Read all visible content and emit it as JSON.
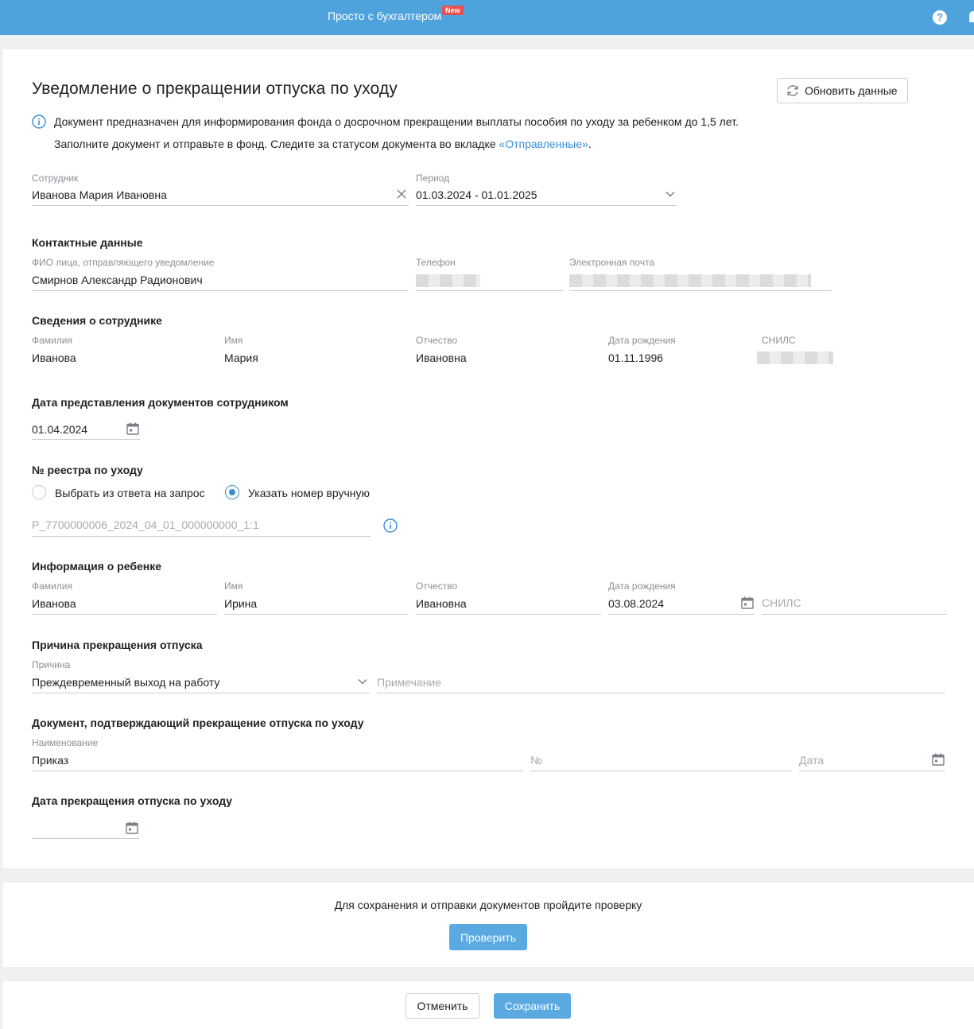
{
  "topbar": {
    "title": "Просто с бухгалтером",
    "badge": "New"
  },
  "header": {
    "title": "Уведомление о прекращении отпуска по уходу",
    "refresh_label": "Обновить данные",
    "info_line1": "Документ предназначен для информирования фонда о досрочном прекращении выплаты пособия по уходу за ребенком до 1,5 лет.",
    "info_line2_prefix": "Заполните документ и отправьте в фонд. Следите за статусом документа во вкладке ",
    "info_link": "«Отправленные»",
    "info_line2_suffix": "."
  },
  "employee": {
    "label": "Сотрудник",
    "value": "Иванова Мария Ивановна",
    "period_label": "Период",
    "period_value": "01.03.2024 - 01.01.2025"
  },
  "contacts": {
    "section": "Контактные данные",
    "fio_label": "ФИО лица, отправляющего уведомление",
    "fio_value": "Смирнов Александр Радионович",
    "phone_label": "Телефон",
    "email_label": "Электронная почта"
  },
  "employee_info": {
    "section": "Сведения о сотруднике",
    "lastname_label": "Фамилия",
    "lastname": "Иванова",
    "firstname_label": "Имя",
    "firstname": "Мария",
    "middlename_label": "Отчество",
    "middlename": "Ивановна",
    "birth_label": "Дата рождения",
    "birth": "01.11.1996",
    "snils_label": "СНИЛС"
  },
  "submit_date": {
    "section": "Дата представления документов сотрудником",
    "value": "01.04.2024"
  },
  "registry": {
    "section": "№ реестра по уходу",
    "option1": "Выбрать из ответа на запрос",
    "option2": "Указать номер вручную",
    "value": "P_7700000006_2024_04_01_000000000_1:1"
  },
  "child": {
    "section": "Информация о ребенке",
    "lastname_label": "Фамилия",
    "lastname": "Иванова",
    "firstname_label": "Имя",
    "firstname": "Ирина",
    "middlename_label": "Отчество",
    "middlename": "Ивановна",
    "birth_label": "Дата рождения",
    "birth": "03.08.2024",
    "snils_placeholder": "СНИЛС"
  },
  "reason": {
    "section": "Причина прекращения отпуска",
    "label": "Причина",
    "value": "Преждевременный выход на работу",
    "note_placeholder": "Примечание"
  },
  "document": {
    "section": "Документ, подтверждающий прекращение отпуска по уходу",
    "name_label": "Наименование",
    "name_value": "Приказ",
    "number_placeholder": "№",
    "date_placeholder": "Дата"
  },
  "end_date": {
    "section": "Дата прекращения отпуска по уходу",
    "value": ""
  },
  "check": {
    "text": "Для сохранения и отправки документов пройдите проверку",
    "button": "Проверить"
  },
  "footer": {
    "cancel": "Отменить",
    "save": "Сохранить"
  },
  "colors": {
    "accent": "#4fa3dd",
    "primary_button": "#5aa9e0",
    "badge": "#e94f4f"
  }
}
